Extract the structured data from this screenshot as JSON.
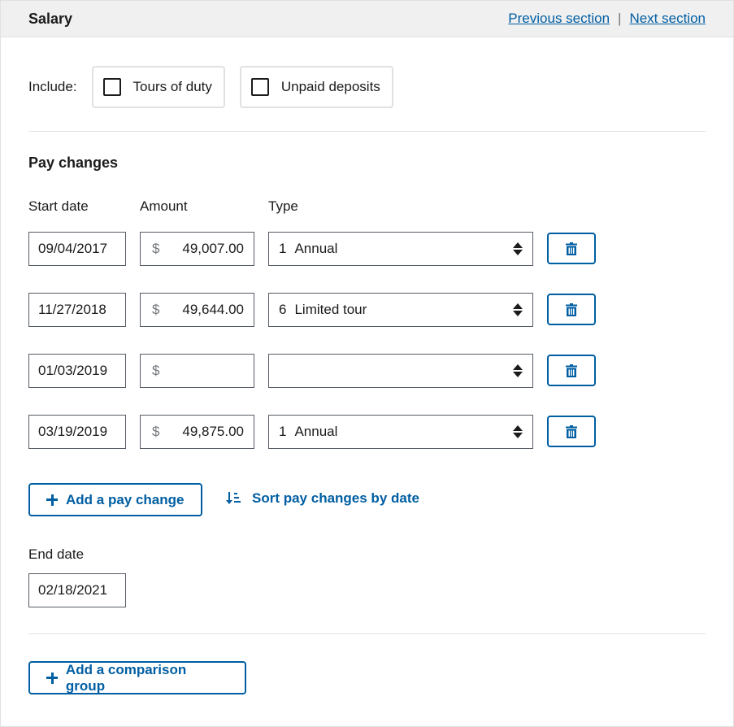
{
  "header": {
    "title": "Salary",
    "prev_link": "Previous section",
    "separator": "|",
    "next_link": "Next section"
  },
  "include": {
    "label": "Include:",
    "options": [
      {
        "label": "Tours of duty",
        "checked": false
      },
      {
        "label": "Unpaid deposits",
        "checked": false
      }
    ]
  },
  "pay_changes": {
    "title": "Pay changes",
    "columns": {
      "start_date": "Start date",
      "amount": "Amount",
      "type": "Type"
    },
    "currency_symbol": "$",
    "rows": [
      {
        "start_date": "09/04/2017",
        "amount": "49,007.00",
        "type_code": "1",
        "type_label": "Annual"
      },
      {
        "start_date": "11/27/2018",
        "amount": "49,644.00",
        "type_code": "6",
        "type_label": "Limited tour"
      },
      {
        "start_date": "01/03/2019",
        "amount": "",
        "type_code": "",
        "type_label": ""
      },
      {
        "start_date": "03/19/2019",
        "amount": "49,875.00",
        "type_code": "1",
        "type_label": "Annual"
      }
    ],
    "add_button": "Add a pay change",
    "sort_link": "Sort pay changes by date"
  },
  "end_date": {
    "label": "End date",
    "value": "02/18/2021"
  },
  "comparison": {
    "add_button": "Add a comparison group"
  },
  "colors": {
    "accent": "#005ea2",
    "header_bg": "#f0f0f0",
    "border": "#dfe1e2",
    "input_border": "#565c65"
  }
}
